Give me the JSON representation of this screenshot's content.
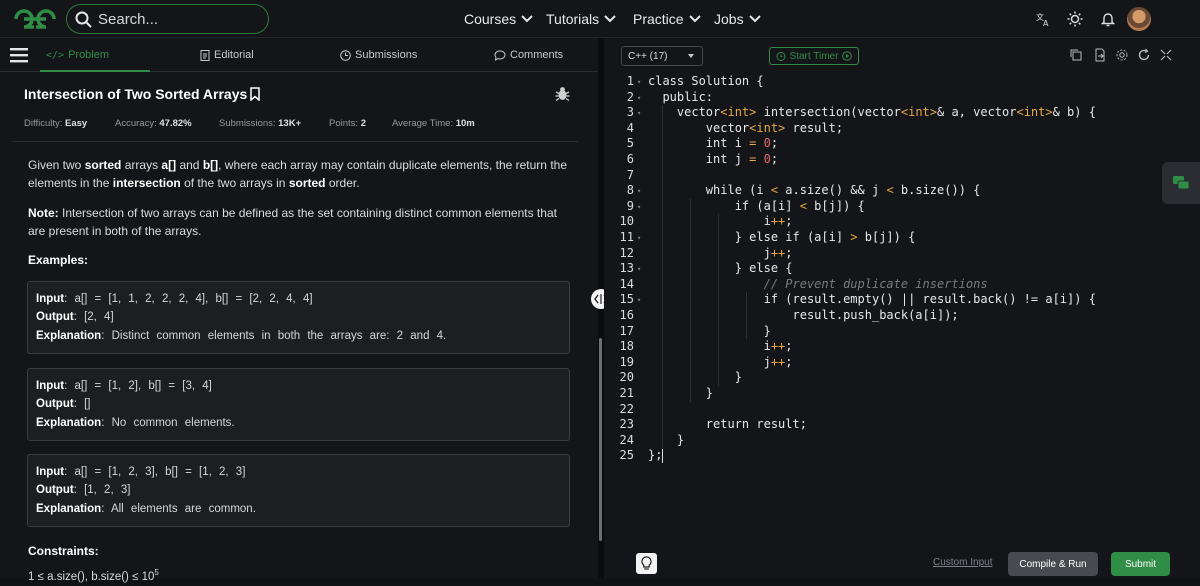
{
  "topbar": {
    "search_placeholder": "Search...",
    "nav": [
      "Courses",
      "Tutorials",
      "Practice",
      "Jobs"
    ]
  },
  "tabs": {
    "problem": "Problem",
    "editorial": "Editorial",
    "submissions": "Submissions",
    "comments": "Comments"
  },
  "problem": {
    "title": "Intersection of Two Sorted Arrays",
    "meta": [
      {
        "label": "Difficulty:",
        "value": "Easy"
      },
      {
        "label": "Accuracy:",
        "value": "47.82%"
      },
      {
        "label": "Submissions:",
        "value": "13K+"
      },
      {
        "label": "Points:",
        "value": "2"
      },
      {
        "label": "Average Time:",
        "value": "10m"
      }
    ],
    "desc": {
      "p1": "Given two",
      "b1": "sorted",
      "p2": "arrays",
      "b2": "a[]",
      "p3": "and",
      "b3": "b[]",
      "p4": ", where each array may contain duplicate elements, the return the",
      "p5": "elements in the",
      "b4": "intersection",
      "p6": "of the two arrays in",
      "b5": "sorted",
      "p7": "order."
    },
    "note": {
      "label": "Note:",
      "text": "Intersection of two arrays can be defined as the set containing distinct common elements that are present in both of the arrays."
    },
    "examples_heading": "Examples:",
    "examples": [
      {
        "input": "a[] = [1, 1, 2, 2, 2, 4], b[] = [2, 2, 4, 4]",
        "output": "[2, 4]",
        "explanation": "Distinct common elements in both the arrays are: 2 and 4."
      },
      {
        "input": "a[] = [1, 2], b[] = [3, 4]",
        "output": "[]",
        "explanation": "No common elements."
      },
      {
        "input": "a[] = [1, 2, 3], b[] = [1, 2, 3]",
        "output": "[1, 2, 3]",
        "explanation": "All elements are common."
      }
    ],
    "labels": {
      "input": "Input",
      "output": "Output",
      "explanation": "Explanation"
    },
    "constraints_heading": "Constraints:",
    "constraint_first": "1 ≤ a.size(), b.size() ≤ 10",
    "constraint_exp": "5"
  },
  "editor": {
    "language": "C++ (17)",
    "timer_label": "Start Timer",
    "lines": [
      "class Solution {",
      "  public:",
      "    vector<int> intersection(vector<int>& a, vector<int>& b) {",
      "        vector<int> result;",
      "        int i = 0;",
      "        int j = 0;",
      "",
      "        while (i < a.size() && j < b.size()) {",
      "            if (a[i] < b[j]) {",
      "                i++;",
      "            } else if (a[i] > b[j]) {",
      "                j++;",
      "            } else {",
      "                // Prevent duplicate insertions",
      "                if (result.empty() || result.back() != a[i]) {",
      "                    result.push_back(a[i]);",
      "                }",
      "                i++;",
      "                j++;",
      "            }",
      "        }",
      "",
      "        return result;",
      "    }",
      "};"
    ]
  },
  "actions": {
    "custom_input": "Custom Input",
    "compile_run": "Compile & Run",
    "submit": "Submit"
  },
  "colors": {
    "accent": "#2f8d46",
    "background": "#131518"
  }
}
